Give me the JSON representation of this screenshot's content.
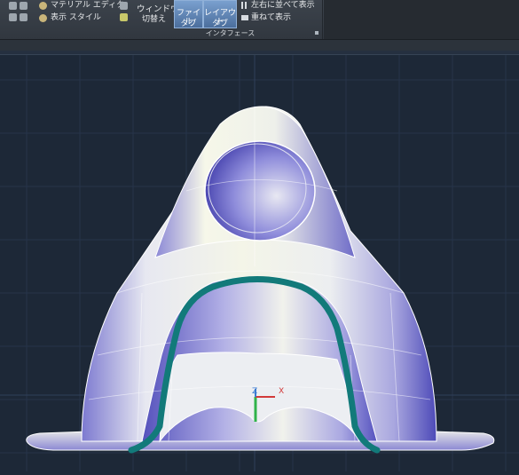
{
  "ribbon": {
    "material_editor_label": "マテリアル エディタ",
    "visual_style_label": "表示 スタイル",
    "switch_window_label_1": "ウィンドウ",
    "switch_window_label_2": "切替え",
    "file_tabs_label_1": "ファイル",
    "file_tabs_label_2": "タブ",
    "layout_tabs_label_1": "レイアウト",
    "layout_tabs_label_2": "タブ",
    "tile_horizontal_label": "左右に並べて表示",
    "cascade_label": "重ねて表示",
    "interface_panel_label": "インタフェース"
  },
  "ucs": {
    "z_label": "Z",
    "x_label": "X",
    "x_color": "#d23a3a",
    "y_color": "#2fb34a",
    "z_color": "#3a7ad2"
  },
  "colors": {
    "background": "#1d2837",
    "model_light": "#f2f3e6",
    "model_shadow": "#5b58c0",
    "highlight_stroke": "#127a7a"
  }
}
